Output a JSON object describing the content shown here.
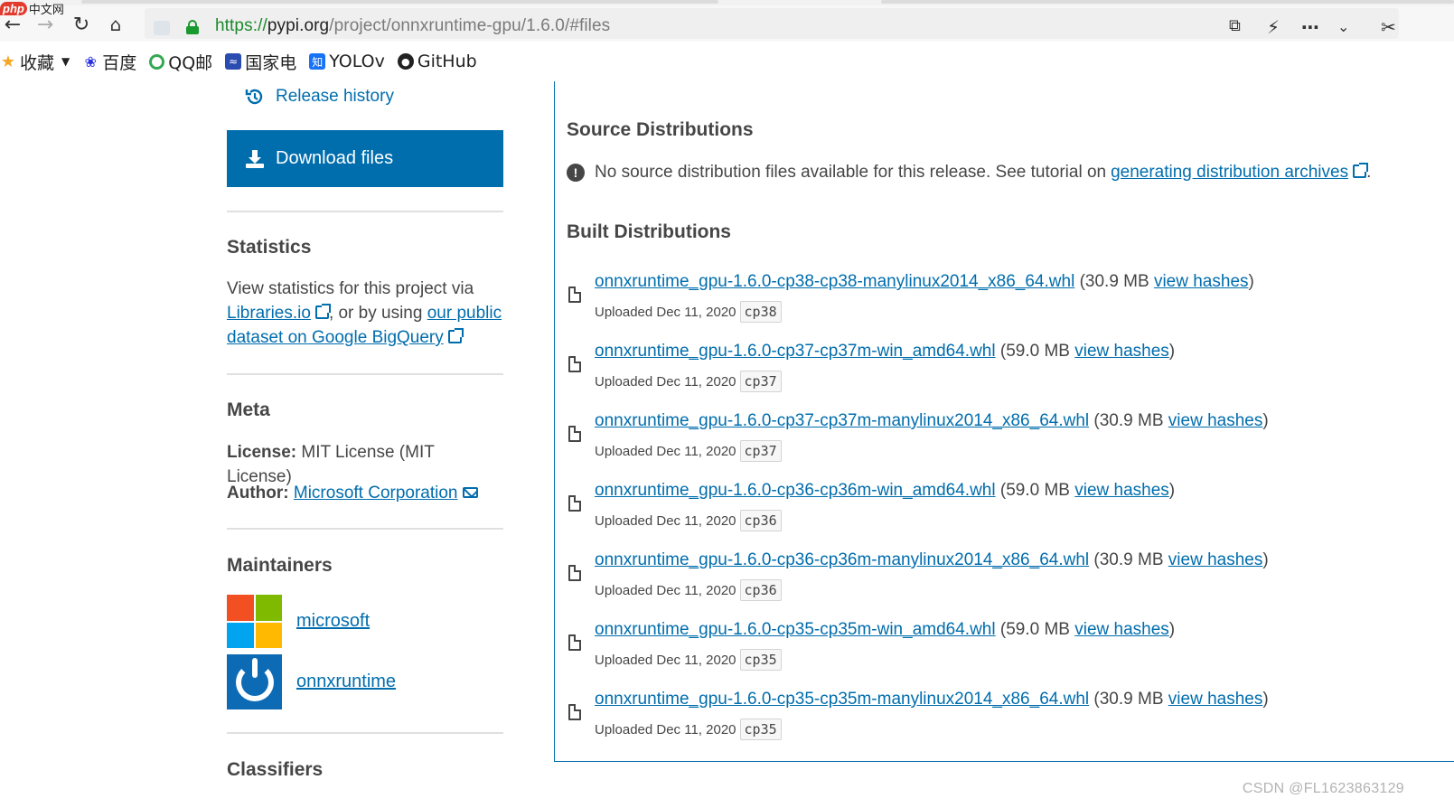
{
  "browser": {
    "watermark_logo": "php中文网",
    "url": {
      "scheme": "https://",
      "host": "pypi.org",
      "path": "/project/onnxruntime-gpu/1.6.0/#files"
    },
    "bookmarks": [
      {
        "label": "收藏",
        "icon": "star-icon",
        "color": "#f5a623"
      },
      {
        "label": "百度",
        "icon": "baidu-paw-icon",
        "color": "#2932e1"
      },
      {
        "label": "QQ邮",
        "icon": "qq-mail-icon",
        "color": "#e23a2d"
      },
      {
        "label": "国家电",
        "icon": "state-grid-icon",
        "color": "#2a4bb0"
      },
      {
        "label": "YOLOv",
        "icon": "zhihu-icon",
        "color": "#1772f6"
      },
      {
        "label": "GitHub",
        "icon": "github-icon",
        "color": "#222222"
      }
    ]
  },
  "sidebar": {
    "release_history": "Release history",
    "download_files": "Download files",
    "statistics": {
      "heading": "Statistics",
      "text_before": "View statistics for this project via",
      "link1": "Libraries.io",
      "text_mid": ", or by using",
      "link2": "our public dataset on Google BigQuery"
    },
    "meta": {
      "heading": "Meta",
      "license_label": "License:",
      "license_value": "MIT License (MIT License)",
      "author_label": "Author:",
      "author_value": "Microsoft Corporation"
    },
    "maintainers": {
      "heading": "Maintainers",
      "users": [
        "microsoft",
        "onnxruntime"
      ]
    },
    "classifiers_heading": "Classifiers"
  },
  "main": {
    "source_heading": "Source Distributions",
    "source_notice": "No source distribution files available for this release. See tutorial on",
    "source_link": "generating distribution archives",
    "built_heading": "Built Distributions",
    "files": [
      {
        "name": "onnxruntime_gpu-1.6.0-cp38-cp38-manylinux2014_x86_64.whl",
        "size": "30.9 MB",
        "uploaded": "Uploaded Dec 11, 2020",
        "tag": "cp38"
      },
      {
        "name": "onnxruntime_gpu-1.6.0-cp37-cp37m-win_amd64.whl",
        "size": "59.0 MB",
        "uploaded": "Uploaded Dec 11, 2020",
        "tag": "cp37"
      },
      {
        "name": "onnxruntime_gpu-1.6.0-cp37-cp37m-manylinux2014_x86_64.whl",
        "size": "30.9 MB",
        "uploaded": "Uploaded Dec 11, 2020",
        "tag": "cp37"
      },
      {
        "name": "onnxruntime_gpu-1.6.0-cp36-cp36m-win_amd64.whl",
        "size": "59.0 MB",
        "uploaded": "Uploaded Dec 11, 2020",
        "tag": "cp36"
      },
      {
        "name": "onnxruntime_gpu-1.6.0-cp36-cp36m-manylinux2014_x86_64.whl",
        "size": "30.9 MB",
        "uploaded": "Uploaded Dec 11, 2020",
        "tag": "cp36"
      },
      {
        "name": "onnxruntime_gpu-1.6.0-cp35-cp35m-win_amd64.whl",
        "size": "59.0 MB",
        "uploaded": "Uploaded Dec 11, 2020",
        "tag": "cp35"
      },
      {
        "name": "onnxruntime_gpu-1.6.0-cp35-cp35m-manylinux2014_x86_64.whl",
        "size": "30.9 MB",
        "uploaded": "Uploaded Dec 11, 2020",
        "tag": "cp35"
      }
    ],
    "view_hashes": "view hashes"
  },
  "watermark": "CSDN @FL1623863129"
}
